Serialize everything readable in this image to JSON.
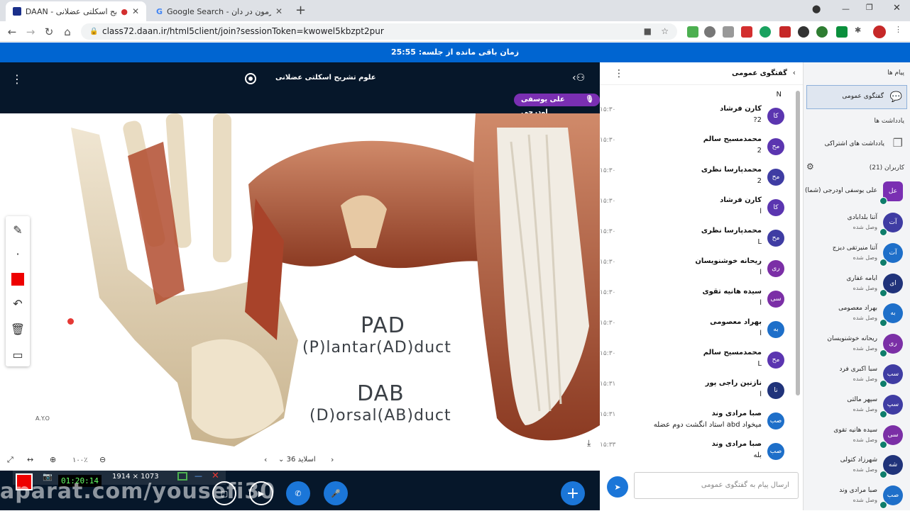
{
  "browser": {
    "tabs": [
      {
        "title": "DAAN - تشریح اسکلتی عضلانی",
        "active": true
      },
      {
        "title": "Google Search - طراحی آزمون در دان",
        "active": false
      }
    ],
    "url": "class72.daan.ir/html5client/join?sessionToken=kwowel5kbzpt2pur"
  },
  "session": {
    "time_remaining": "زمان باقی مانده از جلسه: 25:55"
  },
  "presentation": {
    "title": "علوم تشریح اسکلتی عضلانی",
    "presenter": "علی یوسفی اودرجی",
    "slide_line1": "PAD",
    "slide_line2": "(P)lantar(AD)duct",
    "slide_line3": "DAB",
    "slide_line4": "(D)orsal(AB)duct",
    "watermark_left": "A.Y.O",
    "zoom": "۱۰۰٪",
    "slide_label": "اسلاید 36",
    "minus_label": "−"
  },
  "overlay": {
    "resolution": "1914 × 1073",
    "clock": "01:20:14",
    "watermark": "aparat.com/yousefi30"
  },
  "chat": {
    "header": "گفتگوی عمومی",
    "first_msg_tail": "N",
    "messages": [
      {
        "name": "کارن فرشاد",
        "time": "۱۵:۳۰",
        "text": "?2",
        "avatar": "کا",
        "color": "#5b35b0"
      },
      {
        "name": "محمدمسیح سالم",
        "time": "۱۵:۳۰",
        "text": "2",
        "avatar": "مح",
        "color": "#5b35b0"
      },
      {
        "name": "محمدپارسا نظری",
        "time": "۱۵:۳۰",
        "text": "2",
        "avatar": "مح",
        "color": "#3f3ca3"
      },
      {
        "name": "کارن فرشاد",
        "time": "۱۵:۳۰",
        "text": "l",
        "avatar": "کا",
        "color": "#5b35b0"
      },
      {
        "name": "محمدپارسا نظری",
        "time": "۱۵:۳۰",
        "text": "L",
        "avatar": "مح",
        "color": "#3f3ca3"
      },
      {
        "name": "ریحانه خوشنویسان",
        "time": "۱۵:۳۰",
        "text": "l",
        "avatar": "ری",
        "color": "#7b2fa6"
      },
      {
        "name": "سیده هانیه تقوی",
        "time": "۱۵:۳۰",
        "text": "l",
        "avatar": "سی",
        "color": "#7b2fa6"
      },
      {
        "name": "بهراد معصومی",
        "time": "۱۵:۳۰",
        "text": "l",
        "avatar": "به",
        "color": "#1e6fc9"
      },
      {
        "name": "محمدمسیح سالم",
        "time": "۱۵:۳۰",
        "text": "L",
        "avatar": "مح",
        "color": "#5b35b0"
      },
      {
        "name": "نازنین راجی پور",
        "time": "۱۵:۳۱",
        "text": "l",
        "avatar": "نا",
        "color": "#20337a"
      },
      {
        "name": "صبا مرادی وند",
        "time": "۱۵:۳۱",
        "text": "استاد انگشت دوم عضله abd میخواد",
        "avatar": "صب",
        "color": "#1e6fc9"
      },
      {
        "name": "صبا مرادی وند",
        "time": "۱۵:۳۳",
        "text": "بله",
        "avatar": "صب",
        "color": "#1e6fc9"
      }
    ],
    "input_placeholder": "ارسال پیام به گفتگوی عمومی"
  },
  "sidebar": {
    "messages_title": "پیام ها",
    "public_chat": "گفتگوی عمومی",
    "notes_title": "یادداشت ها",
    "shared_notes": "یادداشت های اشتراکی",
    "users_title": "کاربران (21)",
    "me": "علی یوسفی اودرجی (شما)",
    "users": [
      {
        "name": "آتنا بلدابادی",
        "status": "وصل شده",
        "avatar": "آت",
        "color": "#3f3ca3"
      },
      {
        "name": "آتنا منیرتقی دیزج",
        "status": "وصل شده",
        "avatar": "آت",
        "color": "#1e6fc9"
      },
      {
        "name": "ایامه غفاری",
        "status": "وصل شده",
        "avatar": "ای",
        "color": "#20337a"
      },
      {
        "name": "بهراد معصومی",
        "status": "وصل شده",
        "avatar": "به",
        "color": "#1e6fc9"
      },
      {
        "name": "ریحانه خوشنویسان",
        "status": "وصل شده",
        "avatar": "ری",
        "color": "#7b2fa6"
      },
      {
        "name": "سبا اکبری فرد",
        "status": "وصل شده",
        "avatar": "سب",
        "color": "#3f3ca3"
      },
      {
        "name": "سپهر مالتی",
        "status": "وصل شده",
        "avatar": "سپ",
        "color": "#3f3ca3"
      },
      {
        "name": "سیده هانیه تقوی",
        "status": "وصل شده",
        "avatar": "سی",
        "color": "#7b2fa6"
      },
      {
        "name": "شهرزاد کتولی",
        "status": "وصل شده",
        "avatar": "شه",
        "color": "#20337a"
      },
      {
        "name": "صبا مرادی وند",
        "status": "وصل شده",
        "avatar": "صب",
        "color": "#1e6fc9"
      }
    ]
  }
}
